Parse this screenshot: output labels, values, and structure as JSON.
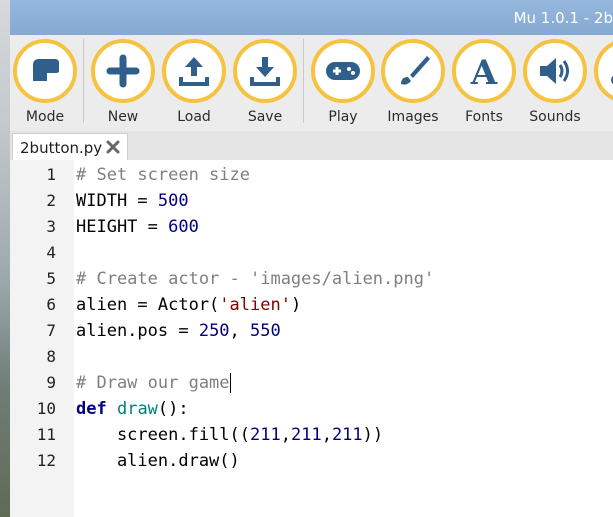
{
  "window": {
    "title": "Mu 1.0.1 - 2b"
  },
  "toolbar": {
    "buttons": [
      {
        "label": "Mode",
        "icon": "mode-icon"
      },
      {
        "label": "New",
        "icon": "plus-icon"
      },
      {
        "label": "Load",
        "icon": "upload-icon"
      },
      {
        "label": "Save",
        "icon": "download-icon"
      },
      {
        "label": "Play",
        "icon": "gamepad-icon"
      },
      {
        "label": "Images",
        "icon": "paintbrush-icon"
      },
      {
        "label": "Fonts",
        "icon": "font-icon"
      },
      {
        "label": "Sounds",
        "icon": "speaker-icon"
      },
      {
        "label": "M",
        "icon": "music-icon"
      }
    ]
  },
  "tabs": [
    {
      "label": "2button.py"
    }
  ],
  "editor": {
    "lines": [
      {
        "n": "1",
        "tokens": [
          {
            "t": "# Set screen size",
            "k": "comment"
          }
        ]
      },
      {
        "n": "2",
        "tokens": [
          {
            "t": "WIDTH = ",
            "k": "plain"
          },
          {
            "t": "500",
            "k": "num"
          }
        ]
      },
      {
        "n": "3",
        "tokens": [
          {
            "t": "HEIGHT = ",
            "k": "plain"
          },
          {
            "t": "600",
            "k": "num"
          }
        ]
      },
      {
        "n": "4",
        "tokens": []
      },
      {
        "n": "5",
        "tokens": [
          {
            "t": "# Create actor - 'images/alien.png'",
            "k": "comment"
          }
        ]
      },
      {
        "n": "6",
        "tokens": [
          {
            "t": "alien = Actor(",
            "k": "plain"
          },
          {
            "t": "'alien'",
            "k": "str"
          },
          {
            "t": ")",
            "k": "plain"
          }
        ]
      },
      {
        "n": "7",
        "tokens": [
          {
            "t": "alien.pos = ",
            "k": "plain"
          },
          {
            "t": "250",
            "k": "num"
          },
          {
            "t": ", ",
            "k": "plain"
          },
          {
            "t": "550",
            "k": "num"
          }
        ]
      },
      {
        "n": "8",
        "tokens": []
      },
      {
        "n": "9",
        "tokens": [
          {
            "t": "# Draw our game",
            "k": "comment"
          }
        ],
        "cursor": true
      },
      {
        "n": "10",
        "tokens": [
          {
            "t": "def",
            "k": "kw"
          },
          {
            "t": " ",
            "k": "plain"
          },
          {
            "t": "draw",
            "k": "fn"
          },
          {
            "t": "():",
            "k": "plain"
          }
        ]
      },
      {
        "n": "11",
        "tokens": [
          {
            "t": "    screen.fill((",
            "k": "plain"
          },
          {
            "t": "211",
            "k": "num"
          },
          {
            "t": ",",
            "k": "plain"
          },
          {
            "t": "211",
            "k": "num"
          },
          {
            "t": ",",
            "k": "plain"
          },
          {
            "t": "211",
            "k": "num"
          },
          {
            "t": "))",
            "k": "plain"
          }
        ]
      },
      {
        "n": "12",
        "tokens": [
          {
            "t": "    alien.draw()",
            "k": "plain"
          }
        ]
      }
    ]
  },
  "colors": {
    "titlebar": "#8fb2da",
    "button_ring": "#f6c340",
    "icon": "#2f5f8a",
    "comment": "#7f7f7f",
    "number": "#00007f",
    "string": "#7f0000",
    "keyword": "#00007f",
    "function": "#007f7f"
  }
}
